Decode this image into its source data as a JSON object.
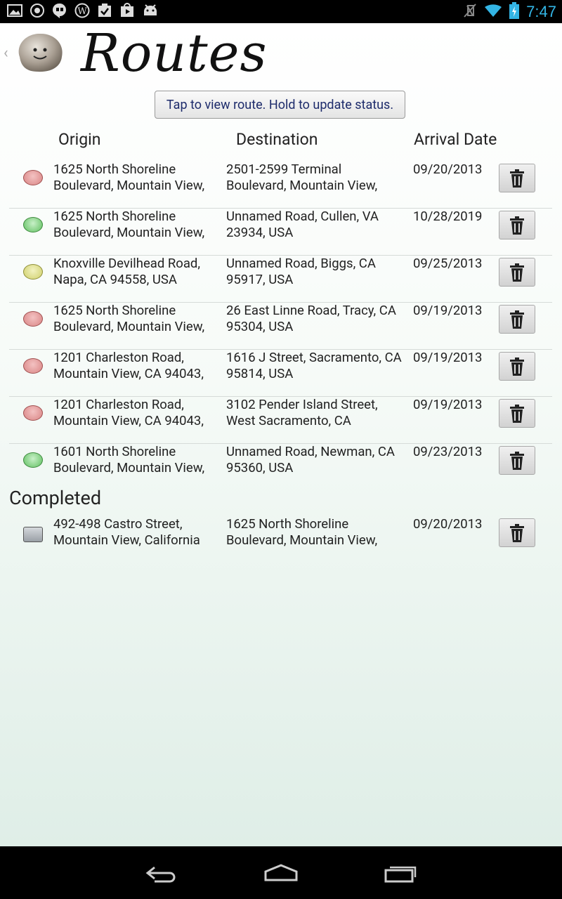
{
  "status_bar": {
    "time": "7:47",
    "icons": [
      "gallery-icon",
      "circle-icon",
      "hangouts-icon",
      "wordpress-icon",
      "tasks-icon",
      "play-store-icon",
      "android-icon"
    ]
  },
  "header": {
    "title": "Routes",
    "hint": "Tap to view route. Hold to update status."
  },
  "columns": {
    "origin": "Origin",
    "destination": "Destination",
    "arrival_date": "Arrival Date"
  },
  "routes": [
    {
      "status": "red",
      "origin": "1625 North Shoreline Boulevard, Mountain View,",
      "destination": "2501-2599 Terminal Boulevard, Mountain View,",
      "date": "09/20/2013"
    },
    {
      "status": "green",
      "origin": "1625 North Shoreline Boulevard, Mountain View,",
      "destination": "Unnamed Road, Cullen, VA 23934, USA",
      "date": "10/28/2019"
    },
    {
      "status": "yellow",
      "origin": "Knoxville Devilhead Road, Napa, CA 94558, USA",
      "destination": "Unnamed Road, Biggs, CA 95917, USA",
      "date": "09/25/2013"
    },
    {
      "status": "red",
      "origin": "1625 North Shoreline Boulevard, Mountain View,",
      "destination": "26 East Linne Road, Tracy, CA 95304, USA",
      "date": "09/19/2013"
    },
    {
      "status": "red",
      "origin": "1201 Charleston Road, Mountain View, CA 94043,",
      "destination": "1616 J Street, Sacramento, CA 95814, USA",
      "date": "09/19/2013"
    },
    {
      "status": "red",
      "origin": "1201 Charleston Road, Mountain View, CA 94043,",
      "destination": "3102 Pender Island Street, West Sacramento, CA",
      "date": "09/19/2013"
    },
    {
      "status": "green",
      "origin": "1601 North Shoreline Boulevard, Mountain View,",
      "destination": "Unnamed Road, Newman, CA 95360, USA",
      "date": "09/23/2013"
    }
  ],
  "completed": {
    "heading": "Completed",
    "routes": [
      {
        "origin": "492-498 Castro Street, Mountain View, California",
        "destination": "1625 North Shoreline Boulevard, Mountain View,",
        "date": "09/20/2013"
      }
    ]
  },
  "colors": {
    "accent": "#33b5e5",
    "hint_text": "#1d2b6b"
  }
}
